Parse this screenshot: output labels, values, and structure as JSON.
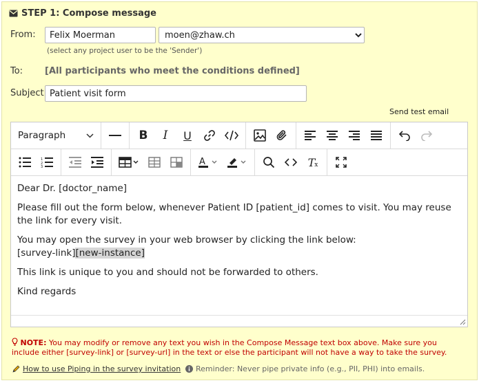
{
  "step": {
    "title": "STEP 1: Compose message",
    "icon": "envelope-icon"
  },
  "from": {
    "label": "From:",
    "name_value": "Felix Moerman",
    "email_selected": "moen@zhaw.ch",
    "hint": "(select any project user to be the 'Sender')"
  },
  "to": {
    "label": "To:",
    "value": "[All participants who meet the conditions defined]"
  },
  "subject": {
    "label": "Subject:",
    "value": "Patient visit form"
  },
  "send_test_email": "Send test email",
  "toolbar": {
    "paragraph_label": "Paragraph",
    "row1_icons": [
      "horizontal-rule-icon",
      "bold-icon",
      "italic-icon",
      "underline-icon",
      "link-icon",
      "code-view-icon",
      "image-icon",
      "attachment-icon",
      "align-left-icon",
      "align-center-icon",
      "align-right-icon",
      "align-justify-icon",
      "undo-icon",
      "redo-icon"
    ],
    "row2_icons": [
      "bullet-list-icon",
      "numbered-list-icon",
      "outdent-icon",
      "indent-icon",
      "table-icon",
      "table-props-icon",
      "table-cell-icon",
      "text-color-icon",
      "highlight-color-icon",
      "search-icon",
      "source-code-icon",
      "clear-format-icon",
      "fullscreen-icon"
    ]
  },
  "body": {
    "greeting": "Dear Dr.  [doctor_name]",
    "para1": "Please fill out the form below, whenever Patient ID [patient_id] comes to visit. You may reuse the link for every visit.",
    "para2_line1": "You may open the survey in your web browser by clicking the link below:",
    "para2_link1": "[survey-link]",
    "para2_link2": "[new-instance]",
    "para3": "This link is unique to you and should not be forwarded to others.",
    "closing": "Kind regards"
  },
  "note": {
    "label": "NOTE:",
    "text": "You may modify or remove any text you wish in the Compose Message text box above. Make sure you include either [survey-link] or [survey-url] in the text or else the participant will not have a way to take the survey."
  },
  "footer": {
    "piping_link": "How to use Piping in the survey invitation",
    "reminder": "Reminder: Never pipe private info (e.g., PII, PHI) into emails."
  },
  "colors": {
    "panel_bg": "#ffffcc",
    "note_red": "#c00000"
  }
}
